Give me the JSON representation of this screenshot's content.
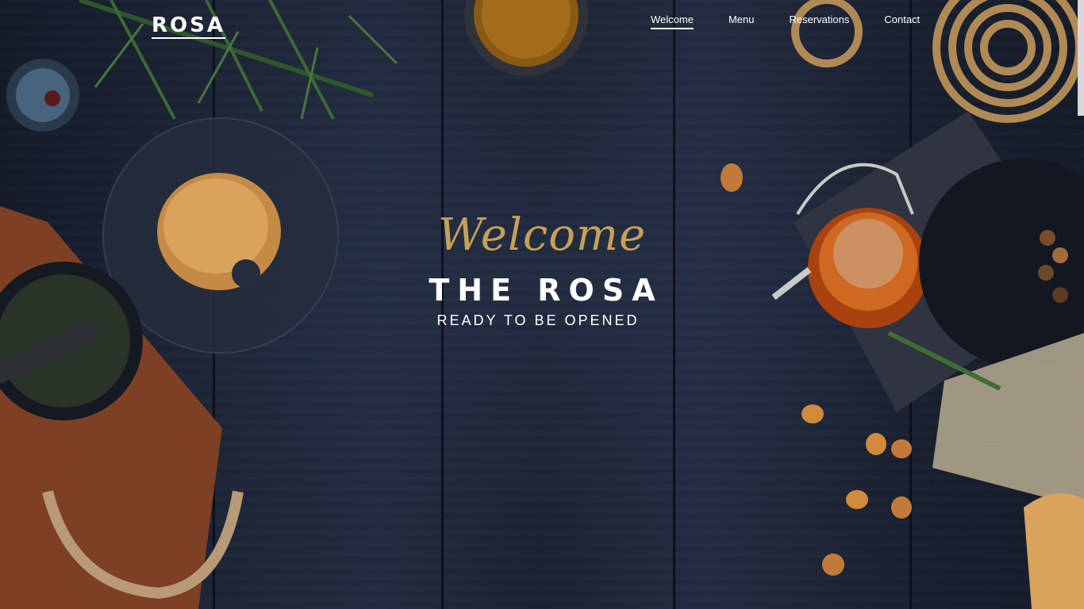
{
  "brand": {
    "logo": "ROSA"
  },
  "nav": {
    "items": [
      {
        "label": "Welcome",
        "active": true
      },
      {
        "label": "Menu",
        "active": false
      },
      {
        "label": "Reservations",
        "active": false
      },
      {
        "label": "Contact",
        "active": false
      }
    ]
  },
  "hero": {
    "script_heading": "Welcome",
    "title": "THE ROSA",
    "subtitle": "READY TO BE OPENED"
  },
  "colors": {
    "accent_gold": "#c5a059",
    "background": "#1c2436",
    "text": "#ffffff"
  }
}
